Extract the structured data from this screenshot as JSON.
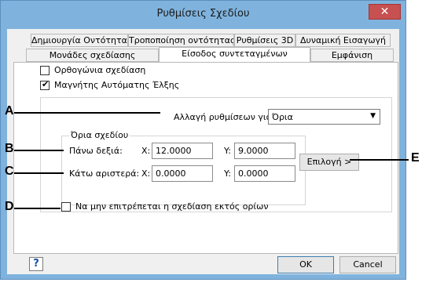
{
  "window": {
    "title": "Ρυθμίσεις Σχεδίου",
    "close_glyph": "✕"
  },
  "tabs": {
    "row1": [
      "Δημιουργία Οντότητας",
      "Τροποποίηση οντότητας",
      "Ρυθμίσεις 3D",
      "Δυναμική Εισαγωγή"
    ],
    "row2": [
      "Μονάδες σχεδίασης",
      "Είσοδος συντεταγμένων",
      "Εμφάνιση"
    ]
  },
  "options": {
    "ortho": {
      "label": "Ορθογώνια σχεδίαση",
      "checked": false
    },
    "snap": {
      "label": "Μαγνήτης Αυτόματης Έλξης",
      "checked": true
    },
    "prevent": {
      "label": "Να μην επιτρέπεται η σχεδίαση εκτός ορίων",
      "checked": false
    }
  },
  "change_settings": {
    "label": "Αλλαγή ρυθμίσεων για :",
    "value": "Όρια"
  },
  "limits": {
    "group_title": "Όρια σχεδίου",
    "upper_right": {
      "label": "Πάνω δεξιά:",
      "x": "12.0000",
      "y": "9.0000"
    },
    "lower_left": {
      "label": "Κάτω αριστερά:",
      "x": "0.0000",
      "y": "0.0000"
    },
    "x_label": "X:",
    "y_label": "Y:"
  },
  "buttons": {
    "select": "Επιλογή >",
    "ok": "OK",
    "cancel": "Cancel",
    "help": "?"
  },
  "callouts": {
    "a": "A",
    "b": "B",
    "c": "C",
    "d": "D",
    "e": "E"
  }
}
